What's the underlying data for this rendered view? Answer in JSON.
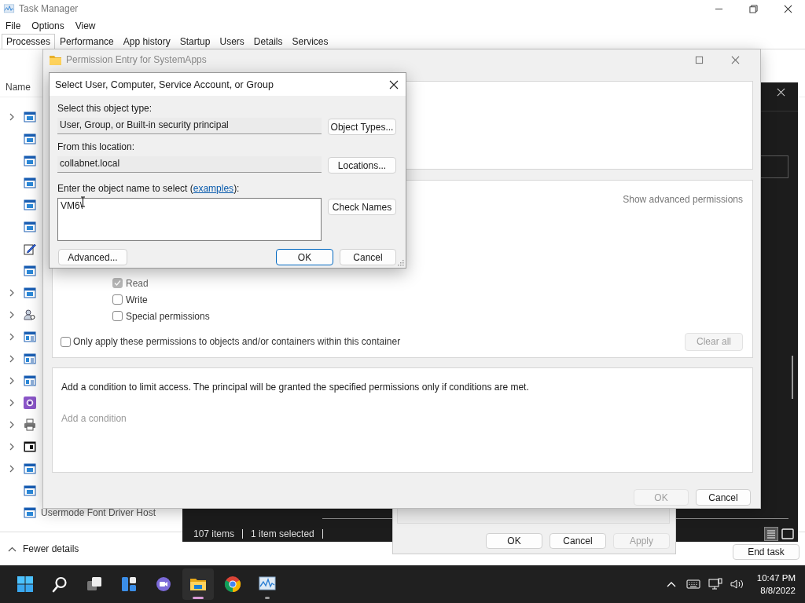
{
  "task_manager": {
    "title": "Task Manager",
    "menu": [
      "File",
      "Options",
      "View"
    ],
    "tabs": [
      {
        "label": "Processes",
        "selected": true
      },
      {
        "label": "Performance",
        "selected": false
      },
      {
        "label": "App history",
        "selected": false
      },
      {
        "label": "Startup",
        "selected": false
      },
      {
        "label": "Users",
        "selected": false
      },
      {
        "label": "Details",
        "selected": false
      },
      {
        "label": "Services",
        "selected": false
      }
    ],
    "column_header": "Name",
    "processes": [
      {
        "expandable": true,
        "kind": "app"
      },
      {
        "expandable": false,
        "kind": "app"
      },
      {
        "expandable": false,
        "kind": "app"
      },
      {
        "expandable": false,
        "kind": "app"
      },
      {
        "expandable": false,
        "kind": "app"
      },
      {
        "expandable": false,
        "kind": "app"
      },
      {
        "expandable": false,
        "kind": "notepad"
      },
      {
        "expandable": false,
        "kind": "app"
      },
      {
        "expandable": true,
        "kind": "app"
      },
      {
        "expandable": true,
        "kind": "user"
      },
      {
        "expandable": true,
        "kind": "applist"
      },
      {
        "expandable": true,
        "kind": "applist"
      },
      {
        "expandable": true,
        "kind": "applist"
      },
      {
        "expandable": true,
        "kind": "service"
      },
      {
        "expandable": true,
        "kind": "printer"
      },
      {
        "expandable": true,
        "kind": "console"
      },
      {
        "expandable": true,
        "kind": "app"
      },
      {
        "expandable": false,
        "kind": "app"
      },
      {
        "expandable": false,
        "kind": "app",
        "name": "Usermode Font Driver Host"
      }
    ],
    "fewer_details": "Fewer details",
    "end_task": "End task"
  },
  "explorer": {
    "status_bar": [
      "107 items",
      "1 item selected"
    ]
  },
  "properties": {
    "buttons": [
      {
        "label": "OK",
        "disabled": false
      },
      {
        "label": "Cancel",
        "disabled": false
      },
      {
        "label": "Apply",
        "disabled": true
      }
    ]
  },
  "permission_entry": {
    "title": "Permission Entry for SystemApps",
    "show_advanced": "Show advanced permissions",
    "permissions": [
      {
        "label": "Read",
        "checked": true,
        "disabled": true
      },
      {
        "label": "Write",
        "checked": false,
        "disabled": false
      },
      {
        "label": "Special permissions",
        "checked": false,
        "disabled": false
      }
    ],
    "only_apply": {
      "label": "Only apply these permissions to objects and/or containers within this container",
      "checked": false
    },
    "clear_all": {
      "label": "Clear all",
      "disabled": true
    },
    "condition_text": "Add a condition to limit access. The principal will be granted the specified permissions only if conditions are met.",
    "add_condition": "Add a condition",
    "buttons": [
      {
        "label": "OK",
        "disabled": true
      },
      {
        "label": "Cancel",
        "disabled": false
      }
    ]
  },
  "select_dialog": {
    "title": "Select User, Computer, Service Account, or Group",
    "object_type_label": "Select this object type:",
    "object_type": "User, Group, or Built-in security principal",
    "object_types_button": "Object Types...",
    "location_label": "From this location:",
    "location": "collabnet.local",
    "locations_button": "Locations...",
    "name_label": "Enter the object name to select (",
    "examples_link": "examples",
    "name_label_end": "):",
    "name_value": "VM6\\",
    "check_names_button": "Check Names",
    "advanced_button": "Advanced...",
    "ok_button": "OK",
    "cancel_button": "Cancel"
  },
  "taskbar": {
    "apps": [
      {
        "kind": "start",
        "open": false,
        "selected": false
      },
      {
        "kind": "search",
        "open": false,
        "selected": false
      },
      {
        "kind": "taskview",
        "open": false,
        "selected": false
      },
      {
        "kind": "widgets",
        "open": false,
        "selected": false
      },
      {
        "kind": "chat",
        "open": false,
        "selected": false
      },
      {
        "kind": "folder",
        "open": true,
        "selected": true
      },
      {
        "kind": "browser",
        "open": false,
        "selected": false
      },
      {
        "kind": "monitor",
        "open": true,
        "selected": false
      }
    ],
    "time": "10:47 PM",
    "date": "8/8/2022"
  }
}
